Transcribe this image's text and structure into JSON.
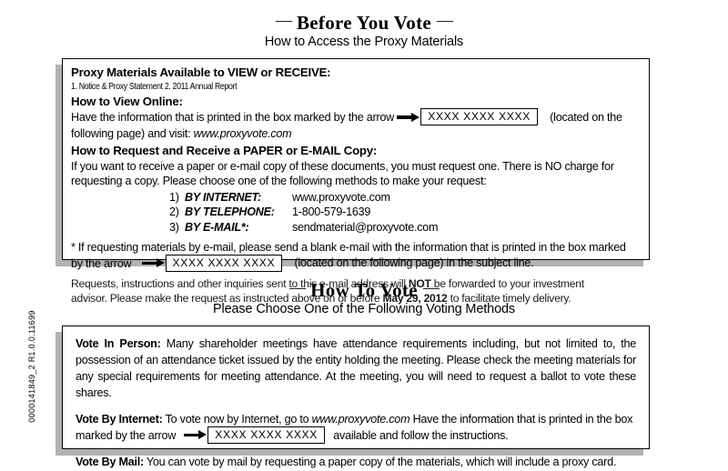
{
  "document": {
    "kind": "proxy-materials-notice",
    "margin_codes": "0000141849_2    R1.0.0.11699"
  },
  "section_before_vote": {
    "dash_left": "—",
    "dash_right": "—",
    "title": "Before You Vote",
    "subtitle": "How to Access the Proxy Materials",
    "available_heading": "Proxy Materials Available to VIEW or RECEIVE:",
    "available_items": "1. Notice & Proxy Statement      2. 2011 Annual Report",
    "view_online_heading": "How to View Online:",
    "view_online_line1_pre": "Have the information that is printed in the box marked by the arrow",
    "control_number": "XXXX XXXX XXXX",
    "view_online_line1_post": "(located on the",
    "view_online_line2_pre": "following page) and visit:",
    "view_online_url": "www.proxyvote.com",
    "request_heading": "How to Request and Receive a PAPER or E-MAIL Copy:",
    "request_line1": "If you want to receive a paper or e-mail copy of these documents, you must request one.  There is NO charge for",
    "request_line2": "requesting a copy.  Please choose one of the following methods to make your request:",
    "methods": [
      {
        "num": "1)",
        "label": "BY INTERNET:",
        "value": "www.proxyvote.com"
      },
      {
        "num": "2)",
        "label": "BY TELEPHONE:",
        "value": "1-800-579-1639"
      },
      {
        "num": "3)",
        "label": "BY E-MAIL*:",
        "value": "sendmaterial@proxyvote.com"
      }
    ],
    "footnote_line1": "*   If requesting materials by e-mail, please send a blank e-mail with the information that is printed in the box marked",
    "footnote_line2_pre": "by the arrow",
    "footnote_line2_post": "(located on the following page) in the subject line.",
    "disclaimer_line1_a": "Requests, instructions and other inquiries sent to this e-mail address will",
    "disclaimer_not": "NOT",
    "disclaimer_line1_b": "be forwarded to your investment",
    "disclaimer_line2_a": "advisor.  Please make the request as instructed above on or before",
    "disclaimer_date": "May 29, 2012",
    "disclaimer_line2_b": "to facilitate timely delivery."
  },
  "section_how_to_vote": {
    "dash_left": "—",
    "dash_right": "—",
    "title": "How To Vote",
    "subtitle": "Please Choose One of the Following Voting Methods",
    "in_person_label": "Vote In Person:",
    "in_person_text": "Many shareholder meetings have attendance requirements including, but not limited to, the possession of an attendance ticket issued by the entity holding the meeting. Please check the meeting materials for any special requirements for meeting attendance. At the meeting, you will need to request a ballot to vote these shares.",
    "internet_label": "Vote By Internet:",
    "internet_text_pre": "To vote now by Internet, go to",
    "internet_url": "www.proxyvote.com",
    "internet_text_mid": "Have the information that is printed in the box marked by the arrow",
    "control_number": "XXXX XXXX XXXX",
    "internet_text_post": "available and follow the instructions.",
    "mail_label": "Vote By Mail:",
    "mail_text": "You can vote by mail by requesting a paper copy of the materials, which will include a proxy card."
  }
}
